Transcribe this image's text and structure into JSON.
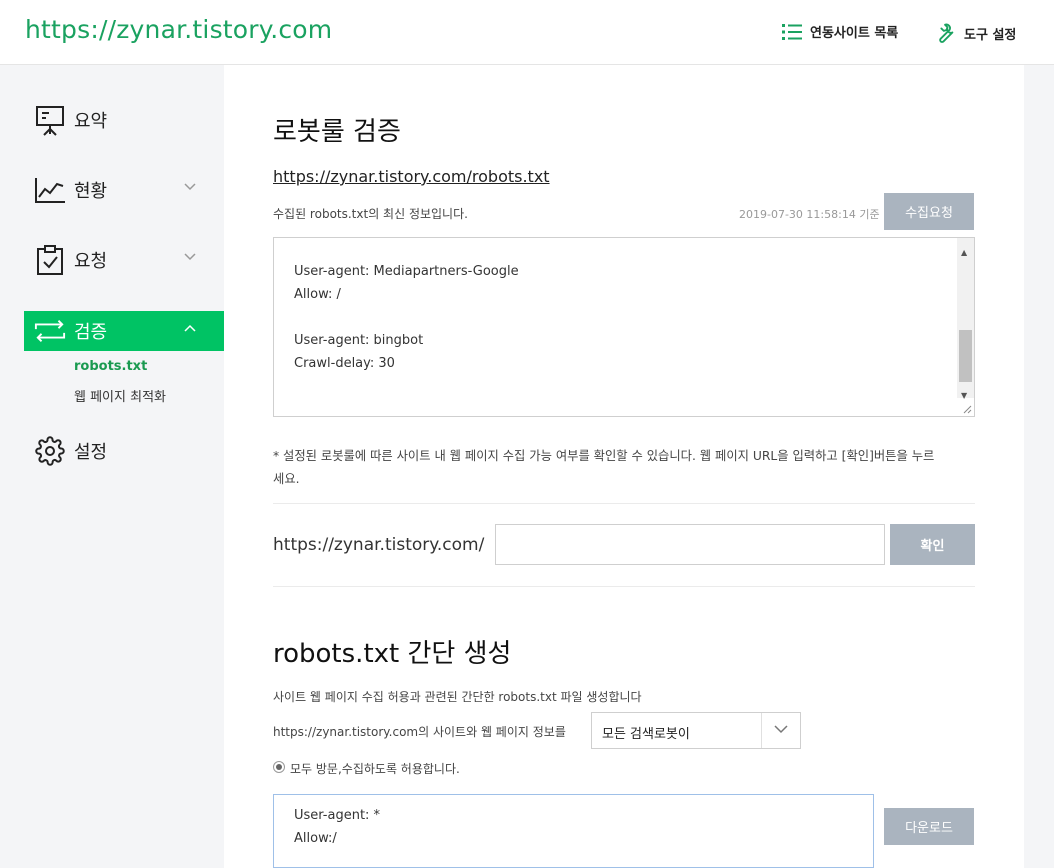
{
  "header": {
    "site_url": "https://zynar.tistory.com",
    "sites_link": "연동사이트 목록",
    "tools_link": "도구 설정"
  },
  "sidebar": {
    "items": [
      {
        "label": "요약",
        "icon": "presentation-board-icon"
      },
      {
        "label": "현황",
        "icon": "line-chart-icon"
      },
      {
        "label": "요청",
        "icon": "clipboard-check-icon"
      },
      {
        "label": "검증",
        "icon": "refresh-arrows-icon"
      },
      {
        "label": "설정",
        "icon": "gear-icon"
      }
    ],
    "sub_items": [
      "robots.txt",
      "웹 페이지 최적화"
    ]
  },
  "verify": {
    "title": "로봇룰 검증",
    "robots_url": "https://zynar.tistory.com/robots.txt",
    "info_text": "수집된 robots.txt의 최신 정보입니다.",
    "timestamp": "2019-07-30 11:58:14 기준",
    "collect_button": "수집요청",
    "robots_content": [
      "User-agent: Mediapartners-Google",
      "Allow: /",
      "",
      "User-agent: bingbot",
      "Crawl-delay: 30"
    ],
    "note_line1": "* 설정된 로봇룰에 따른 사이트 내 웹 페이지 수집 가능 여부를 확인할 수 있습니다. 웹 페이지 URL을 입력하고 [확인]버튼을 누르",
    "note_line2": "세요.",
    "url_prefix": "https://zynar.tistory.com/",
    "url_input_value": "",
    "confirm_button": "확인"
  },
  "generate": {
    "title": "robots.txt 간단 생성",
    "desc": "사이트 웹 페이지 수집 허용과 관련된 간단한 robots.txt 파일 생성합니다",
    "select_prefix": "https://zynar.tistory.com의 사이트와 웹 페이지 정보를",
    "select_value": "모든 검색로봇이",
    "radio_label": "모두 방문,수집하도록 허용합니다.",
    "output_content": [
      "User-agent: *",
      "Allow:/"
    ],
    "download_button": "다운로드"
  },
  "colors": {
    "accent": "#00c364",
    "brand_text": "#1aa260",
    "button_gray": "#aab4bf"
  }
}
